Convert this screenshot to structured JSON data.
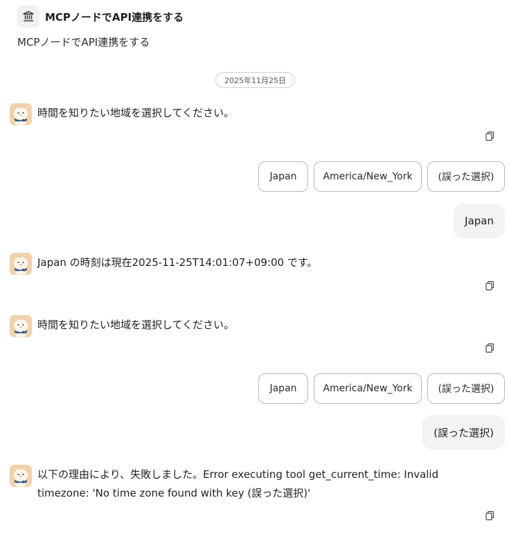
{
  "header": {
    "icon": "bank-icon",
    "title": "MCPノードでAPI連携をする",
    "description": "MCPノードでAPI連携をする"
  },
  "date": "2025年11月25日",
  "messages": {
    "m1": {
      "text": "時間を知りたい地域を選択してください。"
    },
    "choices1": [
      "Japan",
      "America/New_York",
      "(誤った選択)"
    ],
    "u1": "Japan",
    "m2": {
      "text": "Japan の時刻は現在2025-11-25T14:01:07+09:00 です。"
    },
    "m3": {
      "text": "時間を知りたい地域を選択してください。"
    },
    "choices2": [
      "Japan",
      "America/New_York",
      "(誤った選択)"
    ],
    "u2": "(誤った選択)",
    "m4": {
      "text": "以下の理由により、失敗しました。Error executing tool get_current_time: Invalid timezone: 'No time zone found with key (誤った選択)'"
    }
  },
  "icons": {
    "copy": "copy-icon",
    "avatar": "bot-avatar"
  }
}
